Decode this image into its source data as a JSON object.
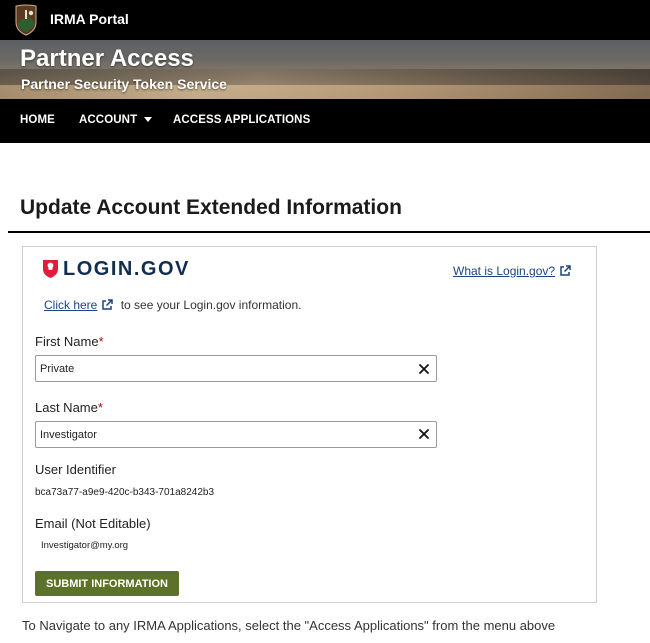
{
  "app": {
    "title": "IRMA Portal",
    "logo_icon": "nps-arrowhead-icon"
  },
  "banner": {
    "title": "Partner Access",
    "subtitle": "Partner Security Token Service"
  },
  "nav": {
    "items": [
      {
        "label": "HOME"
      },
      {
        "label": "ACCOUNT",
        "icon": "caret-down-icon"
      },
      {
        "label": "ACCESS APPLICATIONS"
      }
    ]
  },
  "page": {
    "title": "Update Account Extended Information"
  },
  "login_gov": {
    "wordmark": "LOGIN.GOV",
    "what_link": "What is Login.gov?",
    "click_here": "Click here",
    "info_text": "to see your Login.gov information."
  },
  "form": {
    "first_name": {
      "label": "First Name",
      "required_mark": "*",
      "value": "Private"
    },
    "last_name": {
      "label": "Last Name",
      "required_mark": "*",
      "value": "Investigator"
    },
    "user_identifier": {
      "label": "User Identifier",
      "value": "bca73a77-a9e9-420c-b343-701a8242b3"
    },
    "email": {
      "label": "Email (Not Editable)",
      "value": "Investigator@my.org"
    },
    "submit_label": "SUBMIT INFORMATION"
  },
  "footer": {
    "note": "To Navigate to any IRMA Applications, select the \"Access Applications\" from the menu above"
  },
  "colors": {
    "nav_bg": "#000000",
    "submit_bg": "#5c7228",
    "link": "#1a4480",
    "login_gov_red": "#e21c3d",
    "login_gov_navy": "#112e51",
    "required": "#b50909"
  }
}
